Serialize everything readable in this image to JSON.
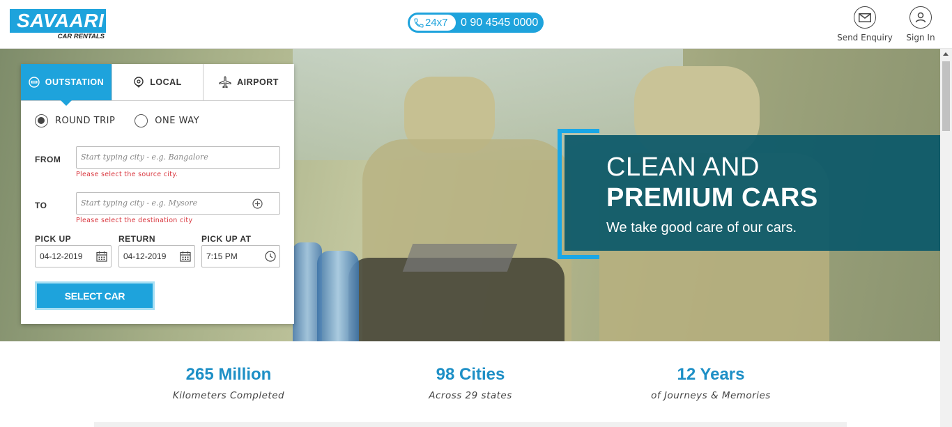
{
  "header": {
    "logo_text": "SAVAARI",
    "logo_sub": "CAR RENTALS",
    "phone_badge": "24x7",
    "phone_number": "0 90 4545 0000",
    "send_enquiry": "Send Enquiry",
    "sign_in": "Sign In"
  },
  "search": {
    "tabs": [
      {
        "label": "OUTSTATION",
        "icon": "car-front-icon",
        "active": true
      },
      {
        "label": "LOCAL",
        "icon": "location-pin-icon",
        "active": false
      },
      {
        "label": "AIRPORT",
        "icon": "airplane-icon",
        "active": false
      }
    ],
    "trip_types": [
      {
        "label": "ROUND TRIP",
        "selected": true
      },
      {
        "label": "ONE WAY",
        "selected": false
      }
    ],
    "from_label": "FROM",
    "from_placeholder": "Start typing city - e.g. Bangalore",
    "from_error": "Please select the source city.",
    "to_label": "TO",
    "to_placeholder": "Start typing city - e.g. Mysore",
    "to_error": "Please select the destination city",
    "pickup_label": "PICK UP",
    "pickup_date": "04-12-2019",
    "return_label": "RETURN",
    "return_date": "04-12-2019",
    "pickup_at_label": "PICK UP AT",
    "pickup_time": "7:15 PM",
    "select_car": "SELECT CAR"
  },
  "promo": {
    "line1": "CLEAN AND",
    "line2": "PREMIUM CARS",
    "line3": "We take good care of our cars."
  },
  "stats": [
    {
      "value": "265 Million",
      "caption": "Kilometers Completed"
    },
    {
      "value": "98 Cities",
      "caption": "Across 29 states"
    },
    {
      "value": "12 Years",
      "caption": "of Journeys & Memories"
    }
  ],
  "colors": {
    "brand": "#1ea3dc",
    "promo_bg": "#0a5869",
    "error": "#d9363e",
    "stat": "#1d8fc6"
  }
}
